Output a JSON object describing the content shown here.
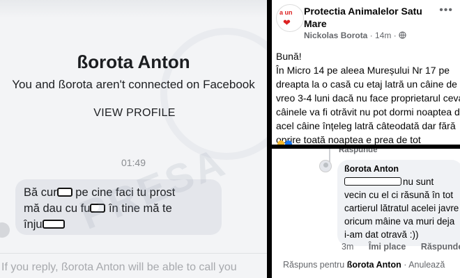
{
  "messenger": {
    "top_partial_text": "",
    "profile_name": "ßorota Anton",
    "connection_text": "You and ßorota aren't connected on Facebook",
    "view_profile_label": "VIEW PROFILE",
    "message_time": "01:49",
    "message": {
      "line1_a": "Bă cur",
      "line1_b": " pe cine faci tu prost",
      "line2_a": "mă dau cu fu",
      "line2_b": " în tine mă te",
      "line3_a": "înju"
    },
    "footer_notice": "If you reply, ßorota Anton will be able to call you",
    "watermark": "PRESA"
  },
  "post": {
    "page_name": "Protectia Animalelor Satu Mare",
    "author": "Nickolas Borota",
    "time": "14m",
    "privacy_icon": "globe-icon",
    "more_icon": "more-dots-icon",
    "logo_text": "a un",
    "body": [
      "Bună!",
      "În Micro 14 pe aleea Mureșului Nr 17 pe",
      "dreapta la o casă cu etaj latră un câine de",
      "vreo 3-4 luni dacă nu face proprietarul ceva",
      "câinele va fi otrăvit nu pot dormi noaptea d",
      "acel câine înțeleg latră câteodată dar fără",
      "oprire toată noaptea e prea de tot"
    ]
  },
  "comment": {
    "previous_reply_label": "Răspunde",
    "author": "ßorota Anton",
    "text": [
      "nu sunt",
      "vecin cu el ci răsună în tot",
      "cartierul lătratul acelei javre",
      "oricum mâine va muri deja",
      "i-am dat otravă :))"
    ],
    "time": "3m",
    "like_label": "Îmi place",
    "reply_label": "Răspunde",
    "reply_for_prefix": "Răspuns pentru",
    "reply_for_name": "ßorota Anton",
    "separator": "·",
    "cancel_label": "Anulează"
  },
  "colors": {
    "border": "#000000",
    "messenger_bg": "#f3f4f6",
    "bubble_bg": "#e4e6eb",
    "fb_text": "#050505",
    "fb_secondary": "#65676b"
  }
}
